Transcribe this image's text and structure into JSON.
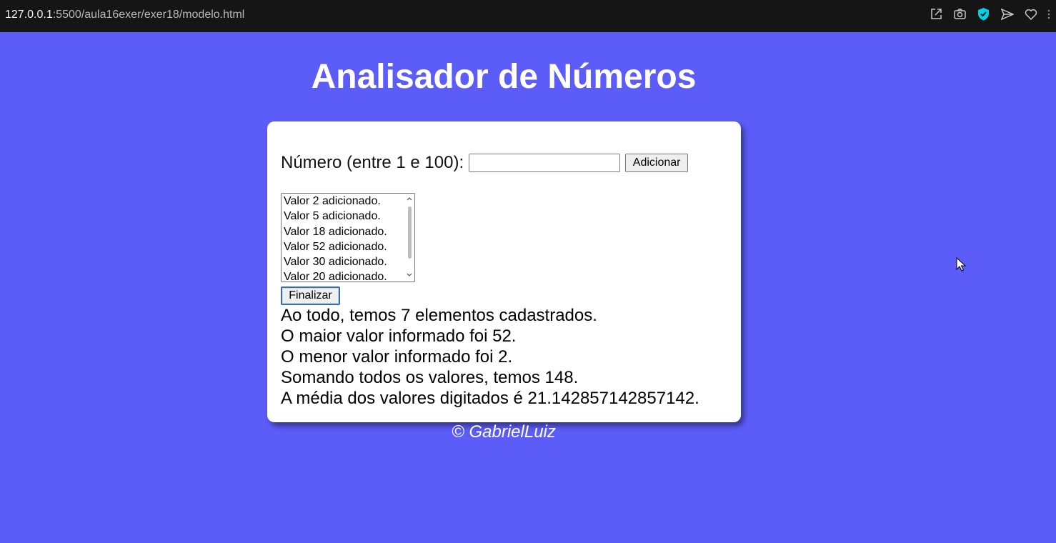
{
  "browser": {
    "url_host": "127.0.0.1",
    "url_path": ":5500/aula16exer/exer18/modelo.html",
    "icons": [
      "share-icon",
      "camera-icon",
      "shield-check-icon",
      "send-icon",
      "heart-icon",
      "more-icon"
    ],
    "shield_color": "#00d2e6"
  },
  "page": {
    "title": "Analisador de Números",
    "background": "#5c5cf8"
  },
  "form": {
    "label": "Número (entre 1 e 100):",
    "input_value": "",
    "add_button": "Adicionar",
    "list_items": [
      "Valor 2 adicionado.",
      "Valor 5 adicionado.",
      "Valor 18 adicionado.",
      "Valor 52 adicionado.",
      "Valor 30 adicionado.",
      "Valor 20 adicionado."
    ],
    "finalize_button": "Finalizar"
  },
  "results": {
    "count": "Ao todo, temos 7 elementos cadastrados.",
    "max": "O maior valor informado foi 52.",
    "min": "O menor valor informado foi 2.",
    "sum": "Somando todos os valores, temos 148.",
    "avg": "A média dos valores digitados é 21.142857142857142."
  },
  "footer": {
    "text": "© GabrielLuiz"
  }
}
